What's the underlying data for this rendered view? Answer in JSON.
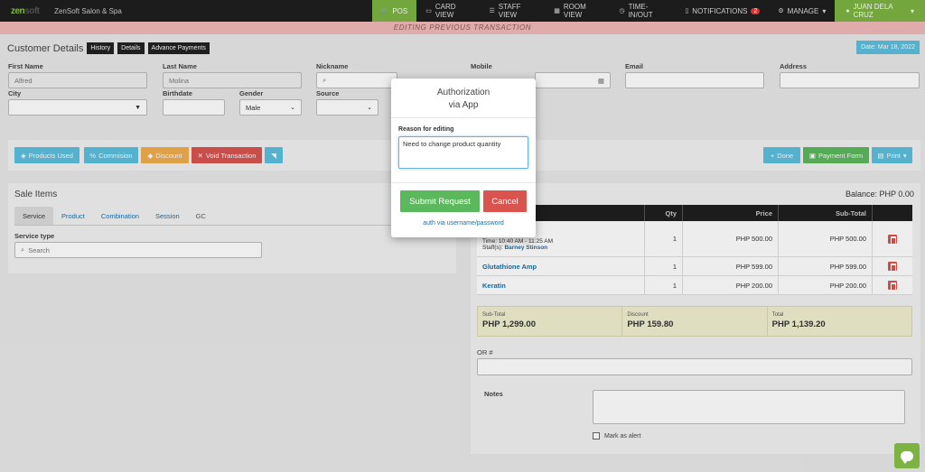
{
  "app": {
    "logo_main": "zen",
    "logo_rest": "soft",
    "brand": "ZenSoft Salon & Spa"
  },
  "nav": [
    {
      "label": "POS",
      "icon": "cart-icon",
      "active": true
    },
    {
      "label": "CARD VIEW",
      "icon": "card-icon"
    },
    {
      "label": "STAFF VIEW",
      "icon": "staff-icon"
    },
    {
      "label": "ROOM VIEW",
      "icon": "room-icon"
    },
    {
      "label": "TIME-IN/OUT",
      "icon": "clock-icon"
    },
    {
      "label": "NOTIFICATIONS",
      "icon": "bell-icon",
      "badge": "2"
    },
    {
      "label": "MANAGE",
      "icon": "gear-icon"
    },
    {
      "label": "JUAN DELA CRUZ",
      "icon": "user-icon"
    }
  ],
  "banner": "EDITING PREVIOUS TRANSACTION",
  "customer": {
    "title": "Customer Details",
    "history_btn": "History",
    "details_btn": "Details",
    "advance_btn": "Advance Payments",
    "date": "Date: Mar 18, 2022",
    "first_name_label": "First Name",
    "first_name": "Alfred",
    "last_name_label": "Last Name",
    "last_name": "Molina",
    "nickname_label": "Nickname",
    "mobile_label": "Mobile",
    "email_label": "Email",
    "address_label": "Address",
    "city_label": "City",
    "birthdate_label": "Birthdate",
    "gender_label": "Gender",
    "gender": "Male",
    "source_label": "Source"
  },
  "actions": {
    "products_used": "Products Used",
    "commision": "Commision",
    "discount": "Discount",
    "void": "Void Transaction",
    "done": "Done",
    "payment_form": "Payment Form",
    "print": "Print"
  },
  "sale": {
    "title": "Sale Items",
    "tabs": [
      "Service",
      "Product",
      "Combination",
      "Session",
      "GC"
    ],
    "service_type_label": "Service type",
    "search_placeholder": "Search",
    "balance": "Balance: PHP 0.00"
  },
  "table": {
    "headers": [
      "",
      "Qty",
      "Price",
      "Sub-Total"
    ],
    "rows": [
      {
        "line1": "Time: 10:40 AM - 11:25 AM",
        "staff_label": "Staff(s):",
        "staff": "Barney Stinson",
        "qty": "1",
        "price": "PHP 500.00",
        "subtotal": "PHP 500.00"
      },
      {
        "name": "Glutathione Amp",
        "qty": "1",
        "price": "PHP 599.00",
        "subtotal": "PHP 599.00"
      },
      {
        "name": "Keratin",
        "qty": "1",
        "price": "PHP 200.00",
        "subtotal": "PHP 200.00"
      }
    ]
  },
  "totals": {
    "subtotal_label": "Sub-Total",
    "subtotal": "PHP 1,299.00",
    "discount_label": "Discount",
    "discount": "PHP 159.80",
    "total_label": "Total",
    "total": "PHP 1,139.20"
  },
  "form": {
    "or_label": "OR #",
    "notes_label": "Notes",
    "mark_alert": "Mark as alert"
  },
  "modal": {
    "title_line1": "Authorization",
    "title_line2": "via App",
    "reason_label": "Reason for editing",
    "reason_value": "Need to change product quantity",
    "submit": "Submit Request",
    "cancel": "Cancel",
    "alt_link": "auth via username/password"
  },
  "colors": {
    "green": "#7cb342",
    "info": "#5bc0de",
    "warning": "#f0ad4e",
    "danger": "#d9534f",
    "submit": "#5cb85c"
  }
}
